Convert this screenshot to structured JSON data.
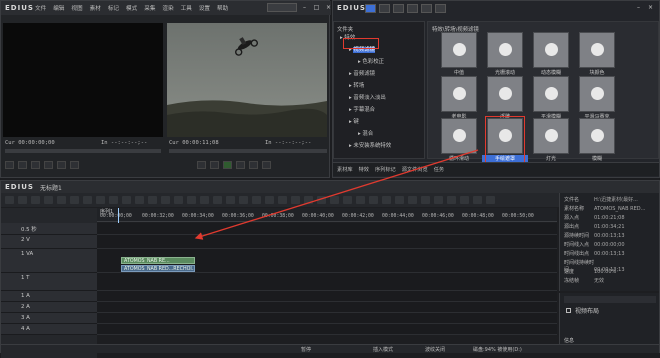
{
  "player": {
    "logo": "EDIUS",
    "menus": [
      "文件",
      "编辑",
      "视图",
      "素材",
      "标记",
      "模式",
      "采集",
      "渲染",
      "工具",
      "设置",
      "帮助"
    ],
    "select_value": "",
    "src_timecode_in": "Cur 00:00:00;00",
    "src_timecode_out": "In --:--:--;--",
    "rec_timecode_in": "Cur 00:00:11;08",
    "rec_timecode_out": "In --:--:--;--"
  },
  "library": {
    "logo": "EDIUS",
    "tree_title": "文件夹",
    "grid_title": "特效\\转场\\视频滤镜",
    "tree": [
      {
        "label": "特效",
        "level": 0
      },
      {
        "label": "视频滤镜",
        "level": 1,
        "selected": true
      },
      {
        "label": "色彩校正",
        "level": 2
      },
      {
        "label": "音频滤镜",
        "level": 1
      },
      {
        "label": "转场",
        "level": 1
      },
      {
        "label": "音频淡入淡出",
        "level": 1
      },
      {
        "label": "字幕混合",
        "level": 1
      },
      {
        "label": "键",
        "level": 1
      },
      {
        "label": "混合",
        "level": 2
      },
      {
        "label": "未安装系统特效",
        "level": 1
      }
    ],
    "effects": [
      {
        "label": "中值",
        "row": 0,
        "col": 0
      },
      {
        "label": "光栅滚动",
        "row": 0,
        "col": 1
      },
      {
        "label": "动态模糊",
        "row": 0,
        "col": 2
      },
      {
        "label": "块颜色",
        "row": 0,
        "col": 3
      },
      {
        "label": "老电影",
        "row": 1,
        "col": 0
      },
      {
        "label": "浮雕",
        "row": 1,
        "col": 1
      },
      {
        "label": "平滑模糊",
        "row": 1,
        "col": 2
      },
      {
        "label": "平滑马赛克",
        "row": 1,
        "col": 3
      },
      {
        "label": "循环滑动",
        "row": 2,
        "col": 0
      },
      {
        "label": "手绘遮罩",
        "row": 2,
        "col": 1,
        "highlight": true
      },
      {
        "label": "灯光",
        "row": 2,
        "col": 2
      },
      {
        "label": "模糊",
        "row": 2,
        "col": 3
      }
    ],
    "bottom_tabs": [
      "素材库",
      "特效",
      "序列标记",
      "源文件浏览",
      "任务"
    ]
  },
  "timeline": {
    "logo": "EDIUS",
    "project_name": "无标题1",
    "sequence_tab": "序列1",
    "ruler": [
      "00:00:00;00",
      "00:00:32;00",
      "00:00:34;00",
      "00:00:36;00",
      "00:00:38;00",
      "00:00:40;00",
      "00:00:42;00",
      "00:00:44;00",
      "00:00:46;00",
      "00:00:48;00",
      "00:00:50;00"
    ],
    "tracks": [
      {
        "label": "0.5 秒"
      },
      {
        "label": "2 V"
      },
      {
        "label": "1 VA"
      },
      {
        "label": "1 T"
      },
      {
        "label": "1 A"
      },
      {
        "label": "2 A"
      },
      {
        "label": "3 A"
      },
      {
        "label": "4 A"
      }
    ],
    "clip_video": "ATOMOS_NAB RE...",
    "clip_audio": "ATOMOS_NAB RED...RECHOI...",
    "status": [
      "暂停",
      "插入模式",
      "波纹关闭",
      "磁盘:94% 被使用(D:)"
    ]
  },
  "properties": {
    "rows": [
      {
        "key": "文件名",
        "value": "H:\\迅捷素材(最好..."
      },
      {
        "key": "素材名称",
        "value": "ATOMOS_NAB RED..."
      },
      {
        "key": "源入点",
        "value": "01:00:21;08"
      },
      {
        "key": "源出点",
        "value": "01:00:34;21"
      },
      {
        "key": "源持续时间",
        "value": "00:00:13;13"
      },
      {
        "key": "时间线入点",
        "value": "00:00:00;00"
      },
      {
        "key": "时间线出点",
        "value": "00:00:13;13"
      },
      {
        "key": "时间线持续时间",
        "value": "00:00:13;13"
      },
      {
        "key": "速度",
        "value": "100.00%"
      },
      {
        "key": "冻结帧",
        "value": "无效"
      }
    ],
    "effects_item": "视频布局",
    "effects_tab": "信息"
  },
  "colors": {
    "accent": "#3d6fd6",
    "highlight": "#e03a2f",
    "clip_video": "#5a8a5e",
    "clip_audio": "#4b6b8c"
  }
}
